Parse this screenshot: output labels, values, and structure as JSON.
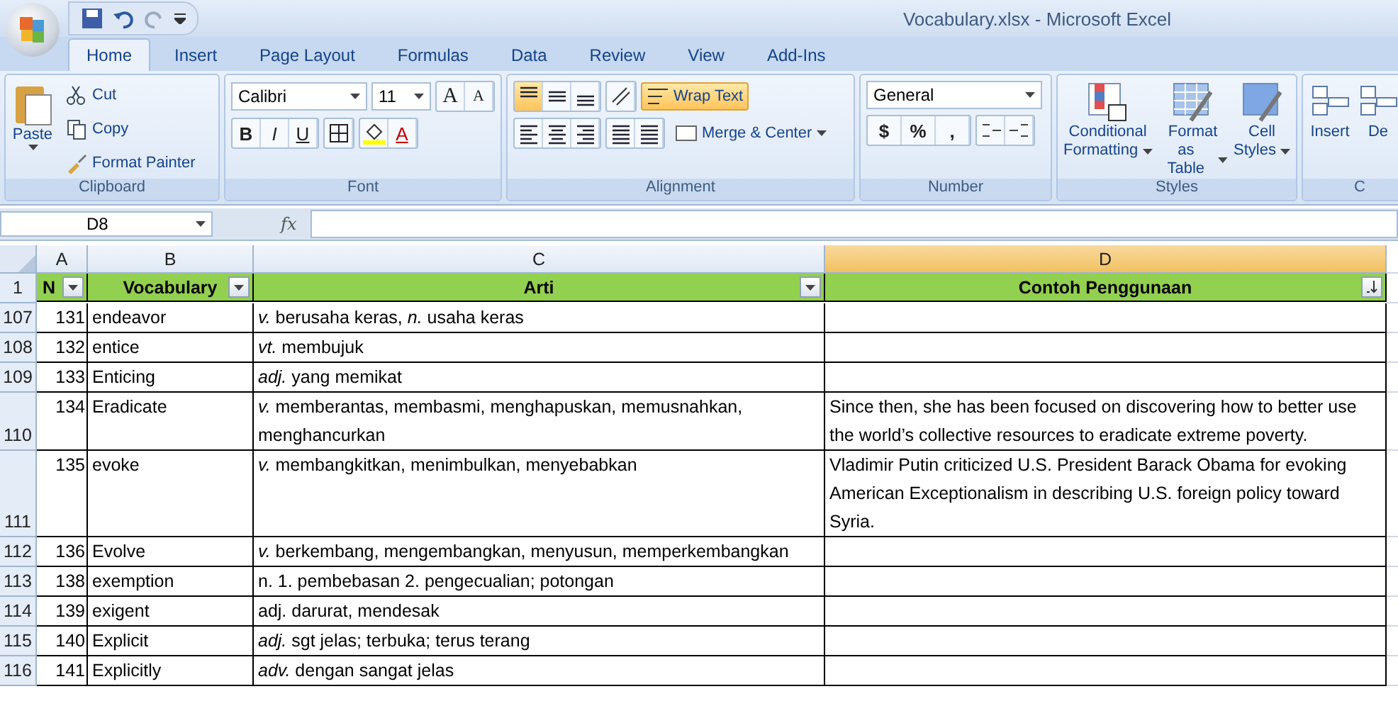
{
  "window": {
    "title": "Vocabulary.xlsx - Microsoft Excel"
  },
  "tabs": [
    {
      "label": "Home",
      "selected": true
    },
    {
      "label": "Insert",
      "selected": false
    },
    {
      "label": "Page Layout",
      "selected": false
    },
    {
      "label": "Formulas",
      "selected": false
    },
    {
      "label": "Data",
      "selected": false
    },
    {
      "label": "Review",
      "selected": false
    },
    {
      "label": "View",
      "selected": false
    },
    {
      "label": "Add-Ins",
      "selected": false
    }
  ],
  "clipboard": {
    "label": "Clipboard",
    "paste": "Paste",
    "items": [
      {
        "label": "Cut",
        "kind": "cut"
      },
      {
        "label": "Copy",
        "kind": "copy"
      },
      {
        "label": "Format Painter",
        "kind": "painter"
      }
    ]
  },
  "font": {
    "label": "Font",
    "name": "Calibri",
    "size": "11",
    "grow": "A",
    "shrink": "A",
    "styles": [
      "B",
      "I",
      "U"
    ],
    "font_color": "A"
  },
  "alignment": {
    "label": "Alignment",
    "vertical": [
      {
        "kind": "top",
        "selected": true
      },
      {
        "kind": "middle",
        "selected": false
      },
      {
        "kind": "bottom",
        "selected": false
      }
    ],
    "horizontal": [
      {
        "kind": "left",
        "selected": false
      },
      {
        "kind": "center",
        "selected": false
      },
      {
        "kind": "right",
        "selected": false
      }
    ],
    "wrap_text": {
      "label": "Wrap Text",
      "selected": true
    },
    "merge": "Merge & Center"
  },
  "number": {
    "label": "Number",
    "format": "General",
    "symbols": [
      "$",
      "%",
      ","
    ]
  },
  "styles": {
    "label": "Styles",
    "items": [
      {
        "line1": "Conditional",
        "line2": "Formatting",
        "kind": "conditional"
      },
      {
        "line1": "Format",
        "line2": "as Table",
        "kind": "table"
      },
      {
        "line1": "Cell",
        "line2": "Styles",
        "kind": "cell"
      }
    ]
  },
  "cells": {
    "label": "C",
    "items": [
      "Insert",
      "De"
    ]
  },
  "formula_bar": {
    "name_box": "D8",
    "fx": "fx"
  },
  "columns": [
    {
      "letter": "A",
      "header": "N",
      "selected": false,
      "sort": false
    },
    {
      "letter": "B",
      "header": "Vocabulary",
      "selected": false,
      "sort": false
    },
    {
      "letter": "C",
      "header": "Arti",
      "selected": false,
      "sort": false
    },
    {
      "letter": "D",
      "header": "Contoh Penggunaan",
      "selected": true,
      "sort": true
    }
  ],
  "header_row": "1",
  "rows": [
    {
      "row": "107",
      "no": "131",
      "word": "endeavor",
      "arti": "*v.*  berusaha keras, *n.*  usaha keras",
      "contoh": ""
    },
    {
      "row": "108",
      "no": "132",
      "word": "entice",
      "arti": "*vt.*  membujuk",
      "contoh": ""
    },
    {
      "row": "109",
      "no": "133",
      "word": "Enticing",
      "arti": "*adj.*  yang memikat",
      "contoh": ""
    },
    {
      "row": "110",
      "no": "134",
      "word": "Eradicate",
      "arti": "*v.*  memberantas, membasmi, menghapuskan, memusnahkan, menghancurkan",
      "contoh": "Since then, she has been focused on discovering how to better use the world’s collective resources to eradicate extreme poverty."
    },
    {
      "row": "111",
      "no": "135",
      "word": "evoke",
      "arti": "*v.*  membangkitkan, menimbulkan, menyebabkan",
      "contoh": "Vladimir Putin criticized U.S. President Barack Obama for evoking American Exceptionalism in describing U.S. foreign policy toward Syria."
    },
    {
      "row": "112",
      "no": "136",
      "word": "Evolve",
      "arti": "*v.*  berkembang, mengembangkan, menyusun, memperkembangkan",
      "contoh": ""
    },
    {
      "row": "113",
      "no": "138",
      "word": "exemption",
      "arti": "n. 1. pembebasan 2. pengecualian; potongan",
      "contoh": ""
    },
    {
      "row": "114",
      "no": "139",
      "word": "exigent",
      "arti": "adj. darurat, mendesak",
      "contoh": ""
    },
    {
      "row": "115",
      "no": "140",
      "word": "Explicit",
      "arti": "*adj.*  sgt jelas; terbuka; terus terang",
      "contoh": ""
    },
    {
      "row": "116",
      "no": "141",
      "word": "Explicitly",
      "arti": "*adv.*  dengan sangat jelas",
      "contoh": ""
    }
  ]
}
